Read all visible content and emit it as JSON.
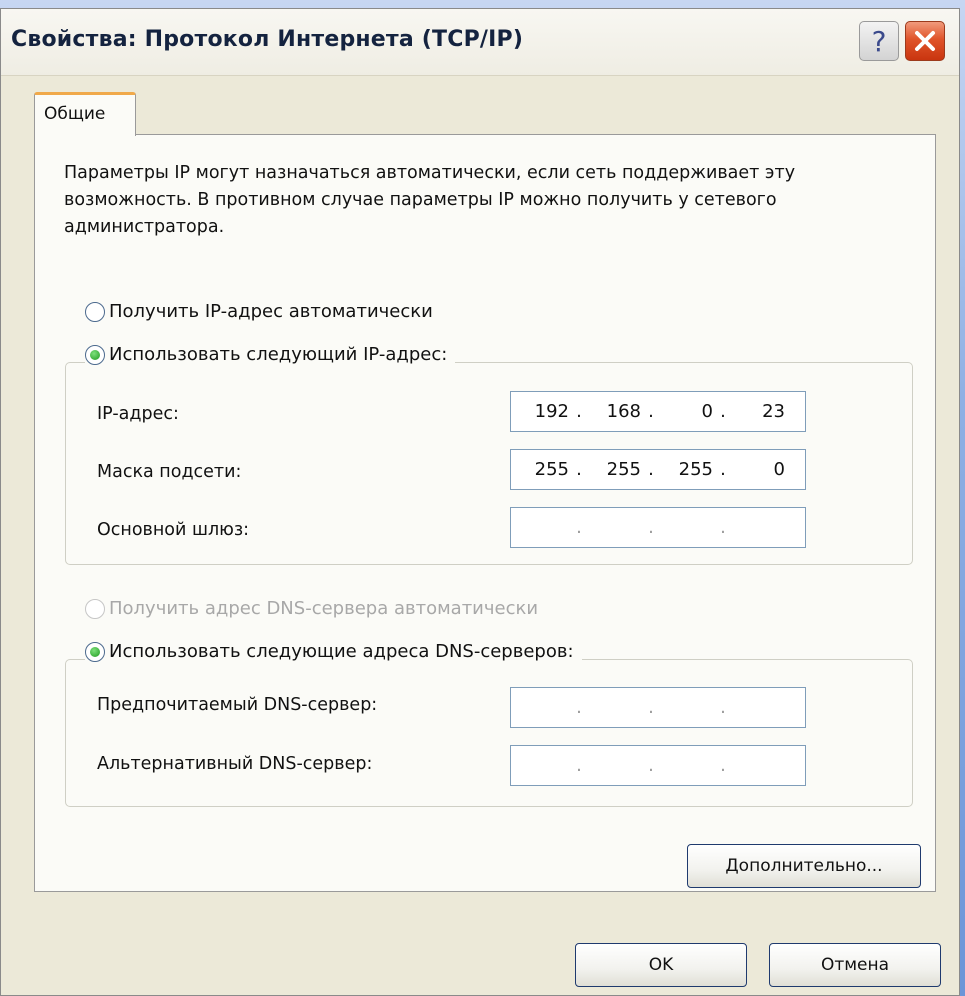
{
  "window": {
    "title": "Свойства: Протокол Интернета (TCP/IP)",
    "help_icon": "help-icon",
    "close_icon": "close-icon"
  },
  "tabs": [
    {
      "label": "Общие",
      "active": true
    }
  ],
  "description": "Параметры IP могут назначаться автоматически, если сеть поддерживает эту возможность. В противном случае параметры IP можно получить у сетевого администратора.",
  "ip_section": {
    "auto_label": "Получить IP-адрес автоматически",
    "manual_label": "Использовать следующий IP-адрес:",
    "selected": "manual",
    "fields": [
      {
        "label": "IP-адрес:",
        "octets": [
          "192",
          "168",
          "0",
          "23"
        ]
      },
      {
        "label": "Маска подсети:",
        "octets": [
          "255",
          "255",
          "255",
          "0"
        ]
      },
      {
        "label": "Основной шлюз:",
        "octets": [
          "",
          "",
          "",
          ""
        ]
      }
    ]
  },
  "dns_section": {
    "auto_label": "Получить адрес DNS-сервера автоматически",
    "auto_disabled": true,
    "manual_label": "Использовать следующие адреса DNS-серверов:",
    "selected": "manual",
    "fields": [
      {
        "label": "Предпочитаемый DNS-сервер:",
        "octets": [
          "",
          "",
          "",
          ""
        ]
      },
      {
        "label": "Альтернативный DNS-сервер:",
        "octets": [
          "",
          "",
          "",
          ""
        ]
      }
    ]
  },
  "buttons": {
    "advanced": "Дополнительно...",
    "ok": "OK",
    "cancel": "Отмена"
  },
  "colors": {
    "window_bg": "#ece9d8",
    "panel_bg": "#fbfbf7",
    "close_red": "#e0542a",
    "radio_green": "#1f9a1f",
    "backdrop_blue": "#6c95d8"
  }
}
